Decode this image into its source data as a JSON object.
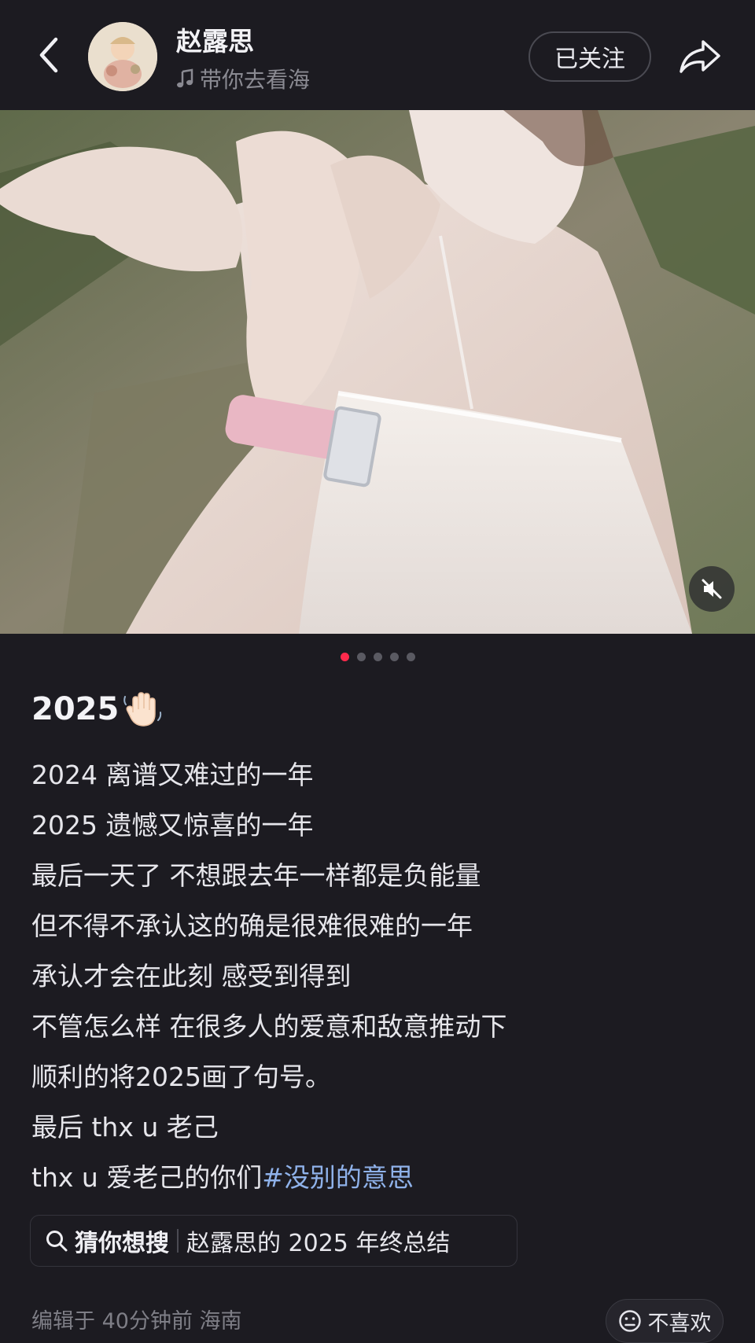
{
  "header": {
    "author_name": "赵露思",
    "music_title": "带你去看海",
    "follow_label": "已关注"
  },
  "carousel": {
    "total": 5,
    "active_index": 0
  },
  "post": {
    "title": "2025",
    "lines": [
      "2024 离谱又难过的一年",
      "2025 遗憾又惊喜的一年",
      "最后一天了 不想跟去年一样都是负能量",
      "但不得不承认这的确是很难很难的一年",
      "承认才会在此刻 感受到得到",
      "不管怎么样 在很多人的爱意和敌意推动下",
      "顺利的将2025画了句号。",
      "最后 thx u 老己"
    ],
    "last_line_prefix": "thx u 爱老己的你们",
    "hashtag": "#没别的意思"
  },
  "suggest": {
    "label": "猜你想搜",
    "query": "赵露思的 2025 年终总结"
  },
  "footer": {
    "meta": "编辑于 40分钟前 海南",
    "dislike_label": "不喜欢"
  },
  "icons": {
    "back": "chevron-left-icon",
    "music": "music-note-icon",
    "share": "share-arrow-icon",
    "mute": "speaker-muted-icon",
    "search": "search-icon",
    "dislike": "neutral-face-icon",
    "title_emoji": "waving-hand-icon"
  },
  "colors": {
    "background": "#1c1b21",
    "accent_red": "#ff2a4c",
    "hashtag_blue": "#8fb2ea"
  }
}
